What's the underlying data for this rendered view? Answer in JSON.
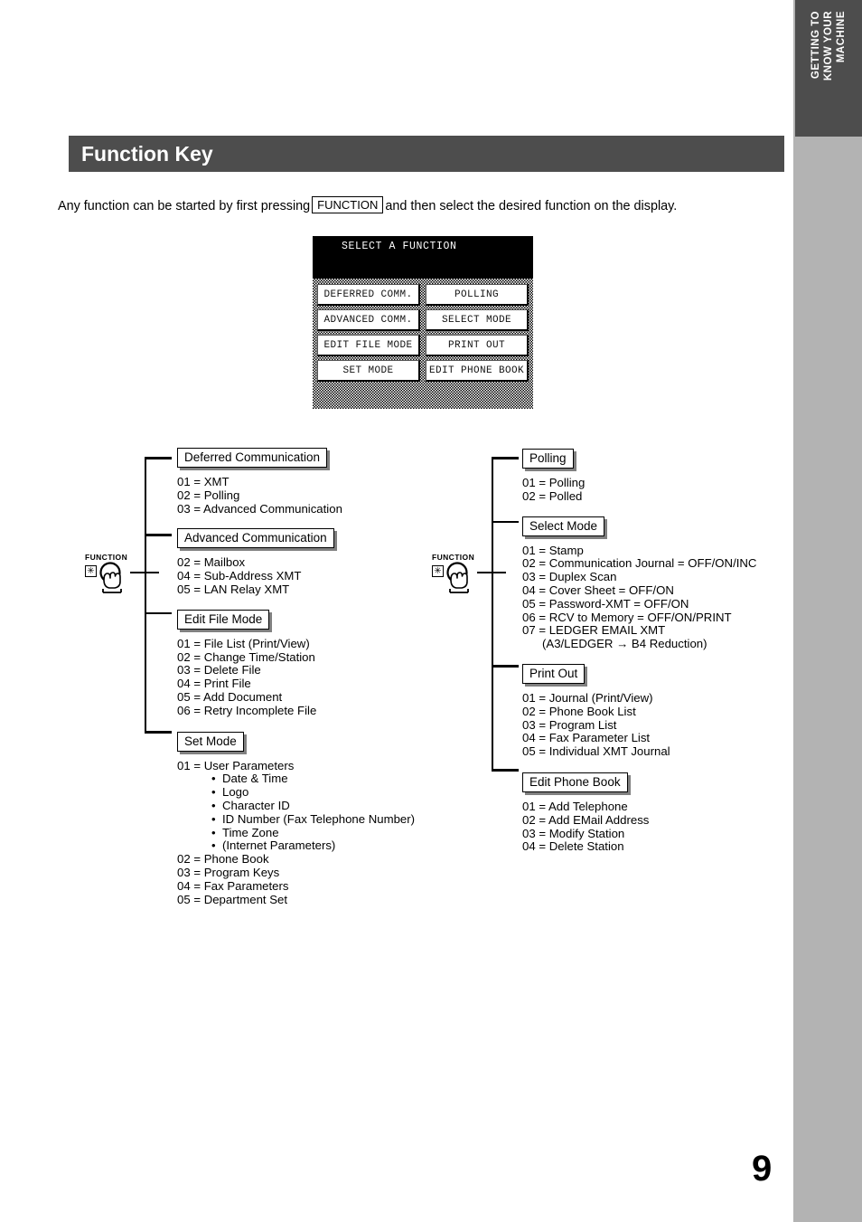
{
  "section_tab": {
    "label": "GETTING TO\nKNOW YOUR\nMACHINE"
  },
  "header": {
    "title": "Function Key"
  },
  "intro": {
    "before": "Any function can be started by first pressing",
    "key": "FUNCTION",
    "after": "and then select the desired function on the display."
  },
  "lcd": {
    "title": "SELECT A FUNCTION",
    "rows": [
      [
        "DEFERRED COMM.",
        "POLLING"
      ],
      [
        "ADVANCED COMM.",
        "SELECT MODE"
      ],
      [
        "EDIT FILE MODE",
        "PRINT OUT"
      ],
      [
        "SET MODE",
        "EDIT PHONE BOOK"
      ]
    ]
  },
  "function_key_icon": {
    "label": "FUNCTION",
    "glyph": "✳"
  },
  "left_column": {
    "nodes": [
      {
        "label": "Deferred Communication",
        "items": [
          "01 = XMT",
          "02 = Polling",
          "03 = Advanced Communication"
        ]
      },
      {
        "label": "Advanced Communication",
        "items": [
          "02 = Mailbox",
          "04 = Sub-Address XMT",
          "05 = LAN Relay XMT"
        ]
      },
      {
        "label": "Edit File Mode",
        "items": [
          "01 = File List (Print/View)",
          "02 = Change Time/Station",
          "03 = Delete File",
          "04 = Print File",
          "05 = Add Document",
          "06 = Retry Incomplete File"
        ]
      },
      {
        "label": "Set Mode",
        "items": [
          "01 = User Parameters"
        ],
        "sub_items": [
          "Date & Time",
          "Logo",
          "Character ID",
          "ID Number (Fax Telephone Number)",
          "Time Zone",
          "(Internet Parameters)"
        ],
        "items_after": [
          "02 = Phone Book",
          "03 = Program Keys",
          "04 = Fax Parameters",
          "05 = Department Set"
        ]
      }
    ]
  },
  "right_column": {
    "nodes": [
      {
        "label": "Polling",
        "items": [
          "01 = Polling",
          "02 = Polled"
        ]
      },
      {
        "label": "Select Mode",
        "items": [
          "01 = Stamp",
          "02 = Communication Journal = OFF/ON/INC",
          "03 = Duplex Scan",
          "04 = Cover Sheet = OFF/ON",
          "05 = Password-XMT = OFF/ON",
          "06 = RCV to Memory = OFF/ON/PRINT",
          "07 = LEDGER EMAIL XMT"
        ],
        "continuation": "(A3/LEDGER → B4 Reduction)"
      },
      {
        "label": "Print Out",
        "items": [
          "01 = Journal (Print/View)",
          "02 = Phone Book List",
          "03 = Program List",
          "04 = Fax Parameter List",
          "05 = Individual XMT Journal"
        ]
      },
      {
        "label": "Edit Phone Book",
        "items": [
          "01 = Add Telephone",
          "02 = Add EMail Address",
          "03 = Modify Station",
          "04 = Delete Station"
        ]
      }
    ]
  },
  "page_number": "9",
  "colors": {
    "header_bar": "#4d4d4d",
    "tab": "#4d4d4d",
    "side_band": "#b3b3b3",
    "lcd_title_bg": "#000000",
    "shadow": "#808080"
  }
}
